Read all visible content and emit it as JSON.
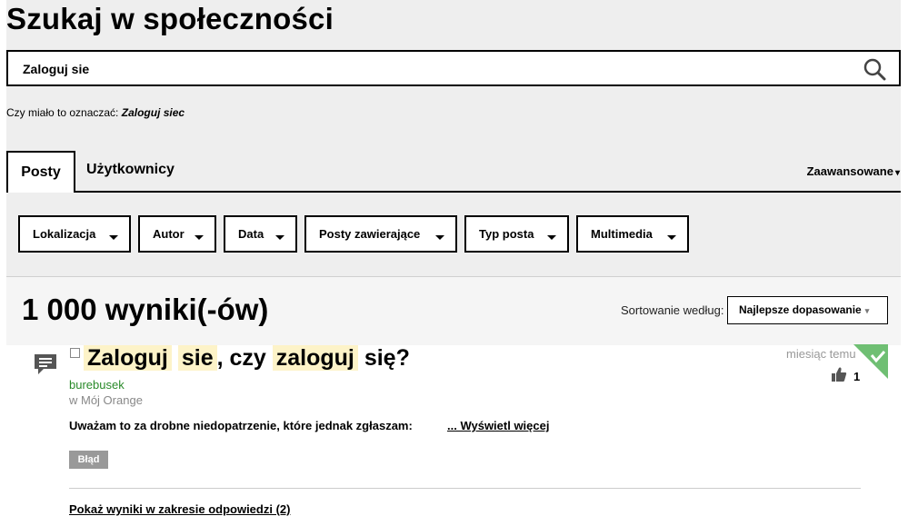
{
  "page": {
    "title": "Szukaj w społeczności"
  },
  "search": {
    "value": "Zaloguj sie",
    "icon": "search-icon"
  },
  "suggestion": {
    "prefix": "Czy miało to oznaczać:",
    "link": "Zaloguj siec"
  },
  "tabs": [
    {
      "label": "Posty",
      "active": true
    },
    {
      "label": "Użytkownicy",
      "active": false
    }
  ],
  "advanced": {
    "label": "Zaawansowane",
    "caret": "▾"
  },
  "filters": [
    {
      "label": "Lokalizacja"
    },
    {
      "label": "Autor"
    },
    {
      "label": "Data"
    },
    {
      "label": "Posty zawierające"
    },
    {
      "label": "Typ posta"
    },
    {
      "label": "Multimedia"
    }
  ],
  "results": {
    "count_text": "1 000 wyniki(-ów)",
    "sort_label": "Sortowanie według:",
    "sort_value": "Najlepsze dopasowanie",
    "sort_caret": "▾"
  },
  "post": {
    "title_parts": [
      {
        "text": "Zaloguj",
        "highlight": true
      },
      {
        "text": " ",
        "highlight": false
      },
      {
        "text": "sie",
        "highlight": true
      },
      {
        "text": ", czy ",
        "highlight": false
      },
      {
        "text": "zaloguj",
        "highlight": true
      },
      {
        "text": " się?",
        "highlight": false
      }
    ],
    "author": "burebusek",
    "board": "w Mój Orange",
    "excerpt": "Uważam to za drobne niedopatrzenie, które jednak zgłaszam:",
    "read_more": "... Wyświetl więcej",
    "label": "Błąd",
    "show_replies": "Pokaż wyniki w zakresie odpowiedzi (2)",
    "time": "miesiąc temu",
    "kudos": "1",
    "solved": true
  },
  "colors": {
    "band": "#eeeeee",
    "highlight": "#fdf3c8",
    "author": "#2a8a2a",
    "solved": "#6fbf73",
    "badge": "#999999"
  }
}
